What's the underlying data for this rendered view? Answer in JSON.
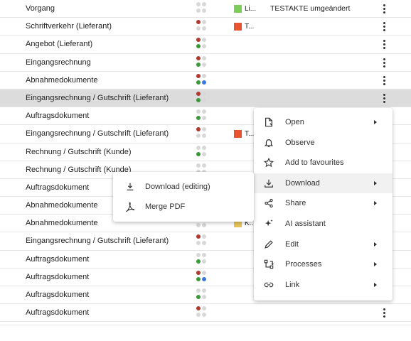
{
  "rows": [
    {
      "name": "Vorgang",
      "dots": [
        "#d8d8d8",
        "#d8d8d8",
        "#d8d8d8",
        "#d8d8d8"
      ],
      "tag_color": "#7ccd5a",
      "tag": "Li...",
      "ref": "TESTAKTE umgeändert",
      "kebab": true
    },
    {
      "name": "Schriftverkehr (Lieferant)",
      "dots": [
        "#b03a2e",
        "#d8d8d8",
        "#d8d8d8",
        "#d8d8d8"
      ],
      "tag_color": "#e8542f",
      "tag": "T...",
      "ref": "",
      "kebab": true
    },
    {
      "name": "Angebot (Lieferant)",
      "dots": [
        "#b03a2e",
        "#d8d8d8",
        "#3a9a3a",
        "#d8d8d8"
      ],
      "tag_color": "",
      "tag": "",
      "ref": "",
      "kebab": true
    },
    {
      "name": "Eingangsrechnung",
      "dots": [
        "#b03a2e",
        "#d8d8d8",
        "#3a9a3a",
        "#d8d8d8"
      ],
      "tag_color": "",
      "tag": "",
      "ref": "",
      "kebab": true
    },
    {
      "name": "Abnahmedokumente",
      "dots": [
        "#b03a2e",
        "#d8d8d8",
        "#3a9a3a",
        "#3b78d8"
      ],
      "tag_color": "",
      "tag": "",
      "ref": "",
      "kebab": true
    },
    {
      "name": "Eingangsrechnung / Gutschrift (Lieferant)",
      "dots": [
        "#b03a2e",
        "#d8d8d8",
        "#3a9a3a",
        "#d8d8d8"
      ],
      "tag_color": "",
      "tag": "",
      "ref": "",
      "kebab": true,
      "selected": true
    },
    {
      "name": "Auftragsdokument",
      "dots": [
        "#d8d8d8",
        "#d8d8d8",
        "#3a9a3a",
        "#d8d8d8"
      ],
      "tag_color": "",
      "tag": "",
      "ref": "",
      "kebab": false
    },
    {
      "name": "Eingangsrechnung / Gutschrift (Lieferant)",
      "dots": [
        "#b03a2e",
        "#d8d8d8",
        "#d8d8d8",
        "#d8d8d8"
      ],
      "tag_color": "#e8542f",
      "tag": "T...",
      "ref": "",
      "kebab": false
    },
    {
      "name": "Rechnung / Gutschrift (Kunde)",
      "dots": [
        "#d8d8d8",
        "#d8d8d8",
        "#3a9a3a",
        "#d8d8d8"
      ],
      "tag_color": "",
      "tag": "",
      "ref": "",
      "kebab": false
    },
    {
      "name": "Rechnung / Gutschrift (Kunde)",
      "dots": [
        "#d8d8d8",
        "#d8d8d8",
        "#d8d8d8",
        "#d8d8d8"
      ],
      "tag_color": "",
      "tag": "",
      "ref": "",
      "kebab": false
    },
    {
      "name": "Auftragsdokument",
      "dots": [
        "#d8d8d8",
        "#d8d8d8",
        "#d8d8d8",
        "#d8d8d8"
      ],
      "tag_color": "",
      "tag": "",
      "ref": "",
      "kebab": false
    },
    {
      "name": "Abnahmedokumente",
      "dots": [
        "#d8d8d8",
        "#d8d8d8",
        "#d8d8d8",
        "#d8d8d8"
      ],
      "tag_color": "",
      "tag": "",
      "ref": "",
      "kebab": false
    },
    {
      "name": "Abnahmedokumente",
      "dots": [
        "#b03a2e",
        "#d8d8d8",
        "#d8d8d8",
        "#d8d8d8"
      ],
      "tag_color": "#e8c65a",
      "tag": "K...",
      "ref": "",
      "kebab": false
    },
    {
      "name": "Eingangsrechnung / Gutschrift (Lieferant)",
      "dots": [
        "#b03a2e",
        "#d8d8d8",
        "#d8d8d8",
        "#d8d8d8"
      ],
      "tag_color": "",
      "tag": "",
      "ref": "",
      "kebab": false
    },
    {
      "name": "Auftragsdokument",
      "dots": [
        "#d8d8d8",
        "#d8d8d8",
        "#3a9a3a",
        "#d8d8d8"
      ],
      "tag_color": "",
      "tag": "",
      "ref": "",
      "kebab": false
    },
    {
      "name": "Auftragsdokument",
      "dots": [
        "#b03a2e",
        "#d8d8d8",
        "#3a9a3a",
        "#3b78d8"
      ],
      "tag_color": "",
      "tag": "",
      "ref": "",
      "kebab": false
    },
    {
      "name": "Auftragsdokument",
      "dots": [
        "#d8d8d8",
        "#d8d8d8",
        "#3a9a3a",
        "#d8d8d8"
      ],
      "tag_color": "",
      "tag": "",
      "ref": "",
      "kebab": false
    },
    {
      "name": "Auftragsdokument",
      "dots": [
        "#b03a2e",
        "#d8d8d8",
        "#d8d8d8",
        "#d8d8d8"
      ],
      "tag_color": "",
      "tag": "",
      "ref": "",
      "kebab": true
    }
  ],
  "context_menu": [
    {
      "label": "Open",
      "icon": "open-file-icon",
      "submenu": true
    },
    {
      "label": "Observe",
      "icon": "bell-icon",
      "submenu": false
    },
    {
      "label": "Add to favourites",
      "icon": "star-icon",
      "submenu": false
    },
    {
      "label": "Download",
      "icon": "download-icon",
      "submenu": true,
      "hover": true
    },
    {
      "label": "Share",
      "icon": "share-icon",
      "submenu": true
    },
    {
      "label": "AI assistant",
      "icon": "sparkle-icon",
      "submenu": false
    },
    {
      "label": "Edit",
      "icon": "pencil-icon",
      "submenu": true
    },
    {
      "label": "Processes",
      "icon": "process-icon",
      "submenu": true
    },
    {
      "label": "Link",
      "icon": "link-icon",
      "submenu": true
    }
  ],
  "download_submenu": [
    {
      "label": "Download (editing)",
      "icon": "download-editing-icon"
    },
    {
      "label": "Merge PDF",
      "icon": "pdf-icon"
    }
  ]
}
